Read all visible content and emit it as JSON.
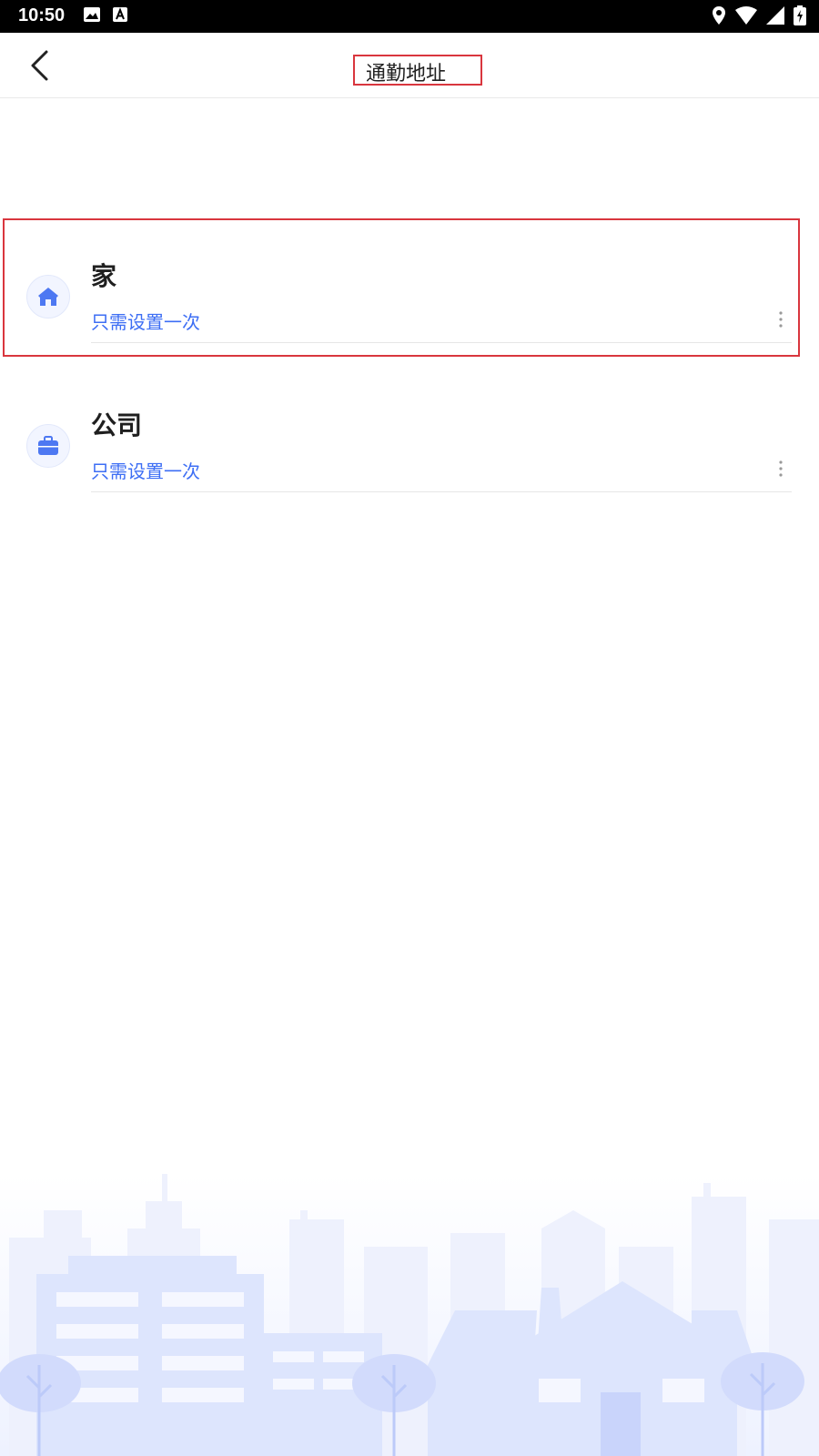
{
  "status_bar": {
    "time": "10:50",
    "icons_left": [
      "image-icon",
      "a-box-icon"
    ],
    "icons_right": [
      "location-icon",
      "wifi-icon",
      "signal-icon",
      "battery-charging-icon"
    ]
  },
  "header": {
    "back_icon": "chevron-left-icon",
    "title": "通勤地址"
  },
  "addresses": [
    {
      "name": "家",
      "subtitle": "只需设置一次",
      "icon": "home-icon"
    },
    {
      "name": "公司",
      "subtitle": "只需设置一次",
      "icon": "briefcase-icon"
    }
  ],
  "colors": {
    "accent": "#3d6ef4",
    "highlight": "#d9363e",
    "skyline": "#c9d4fb"
  }
}
